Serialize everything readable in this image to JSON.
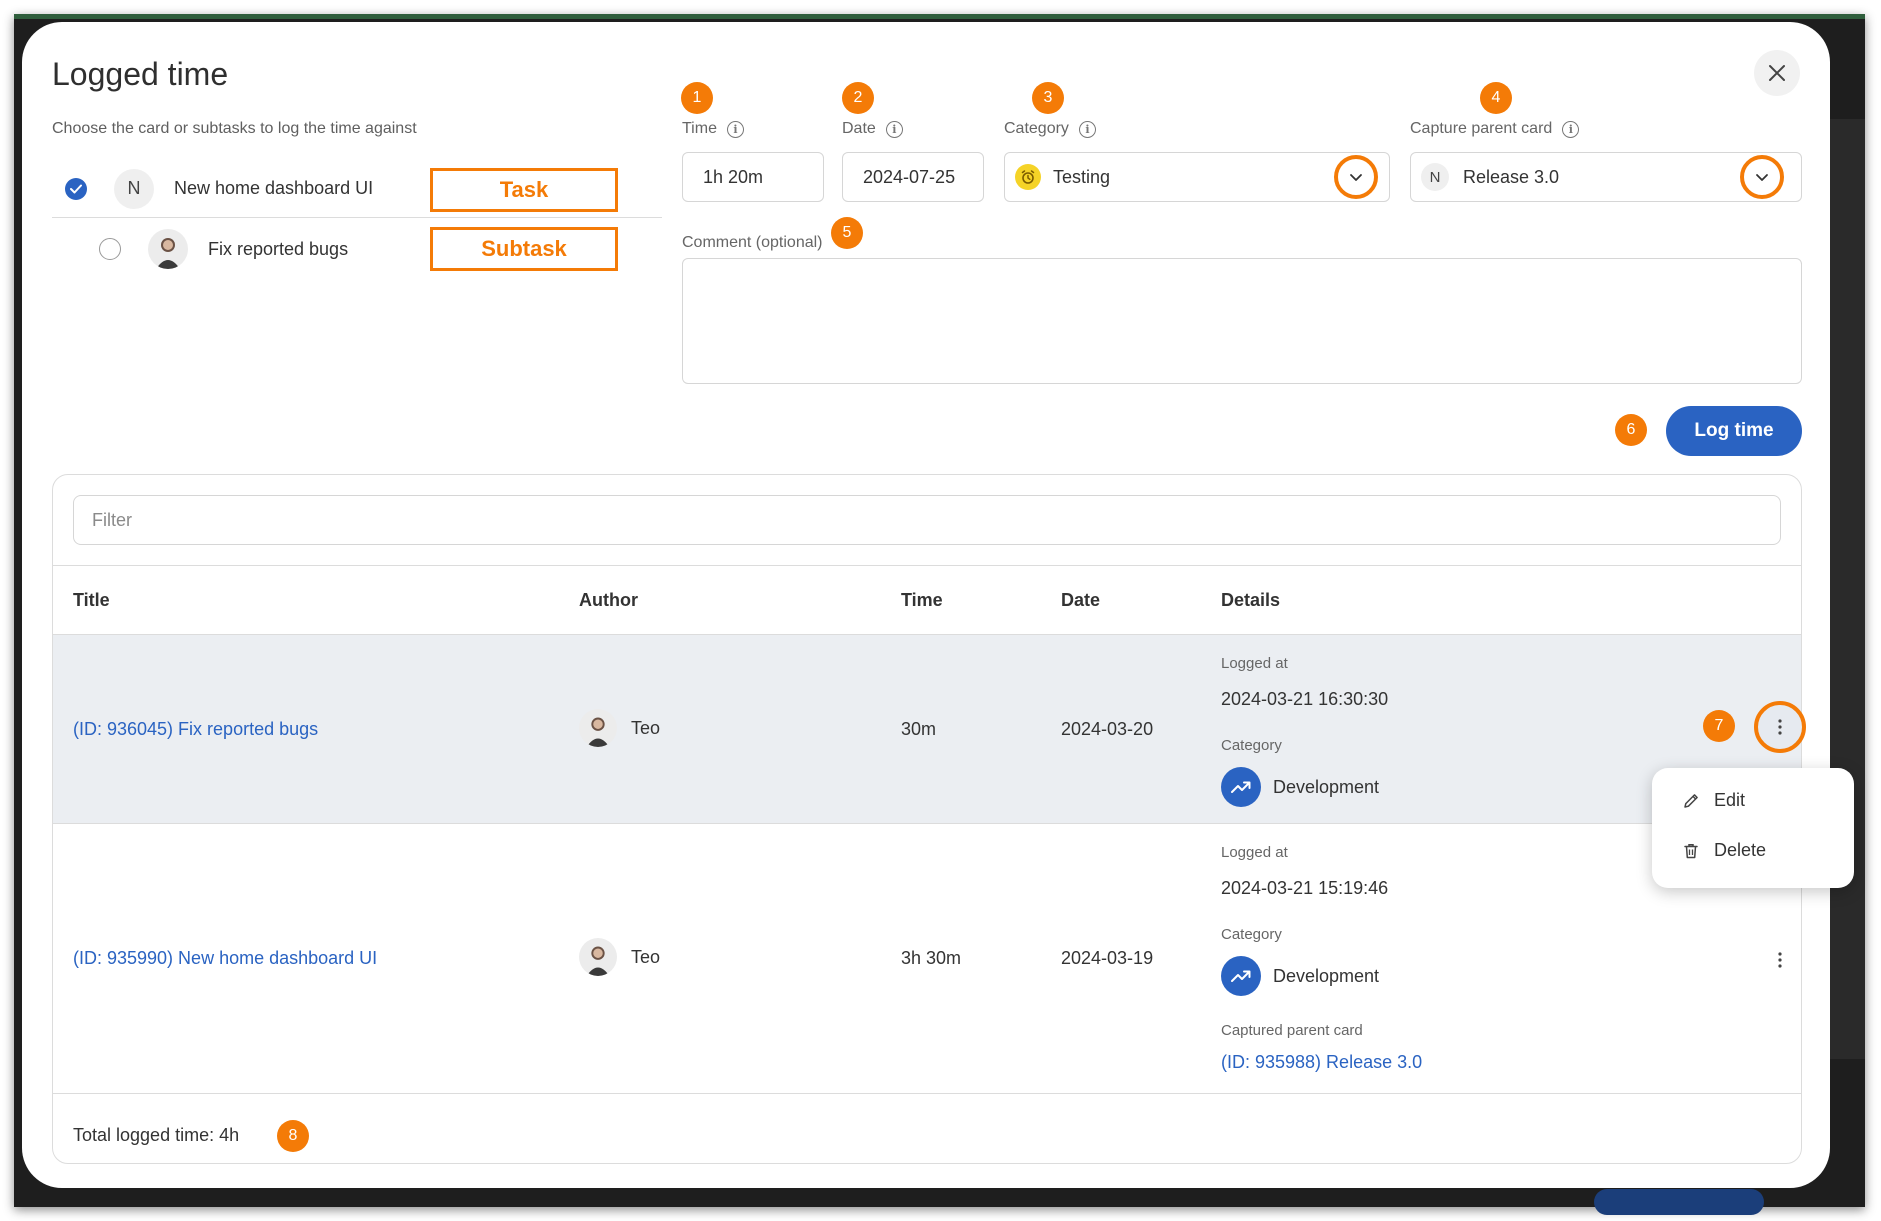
{
  "modal": {
    "title": "Logged time",
    "subtitle": "Choose the card or subtasks to log the time against"
  },
  "cards": [
    {
      "avatar": "N",
      "label": "New home dashboard UI",
      "selected": true,
      "annotation": "Task"
    },
    {
      "avatar": "photo",
      "label": "Fix reported bugs",
      "selected": false,
      "annotation": "Subtask"
    }
  ],
  "badges": [
    "1",
    "2",
    "3",
    "4",
    "5",
    "6",
    "7",
    "8"
  ],
  "form": {
    "time": {
      "label": "Time",
      "value": "1h 20m"
    },
    "date": {
      "label": "Date",
      "value": "2024-07-25"
    },
    "category": {
      "label": "Category",
      "value": "Testing"
    },
    "parent_card": {
      "label": "Capture parent card",
      "avatar": "N",
      "value": "Release 3.0"
    },
    "comment": {
      "label": "Comment (optional)",
      "value": ""
    },
    "log_button": "Log time"
  },
  "table": {
    "filter_placeholder": "Filter",
    "columns": [
      "Title",
      "Author",
      "Time",
      "Date",
      "Details"
    ],
    "rows": [
      {
        "title": "(ID: 936045) Fix reported bugs",
        "author": "Teo",
        "time": "30m",
        "date": "2024-03-20",
        "logged_at_label": "Logged at",
        "logged_at": "2024-03-21 16:30:30",
        "category_label": "Category",
        "category": "Development"
      },
      {
        "title": "(ID: 935990) New home dashboard UI",
        "author": "Teo",
        "time": "3h 30m",
        "date": "2024-03-19",
        "logged_at_label": "Logged at",
        "logged_at": "2024-03-21 15:19:46",
        "category_label": "Category",
        "category": "Development",
        "parent_label": "Captured parent card",
        "parent": "(ID: 935988) Release 3.0"
      }
    ],
    "total": "Total logged time: 4h"
  },
  "context_menu": {
    "items": [
      {
        "label": "Edit",
        "icon": "pencil-icon"
      },
      {
        "label": "Delete",
        "icon": "trash-icon"
      }
    ]
  },
  "colors": {
    "accent": "#2a63c2",
    "annotation": "#f47b07",
    "row_highlight": "#ebeef2"
  }
}
